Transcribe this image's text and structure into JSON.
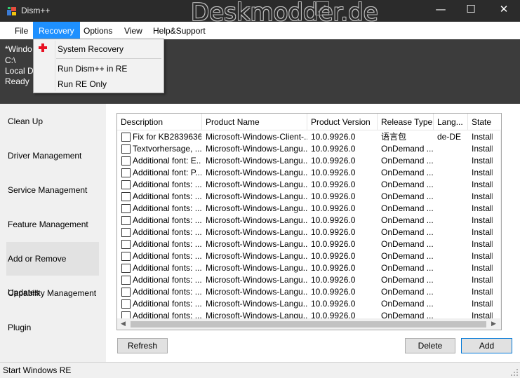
{
  "window": {
    "title": "Dism++",
    "watermark": "Deskmodder.de",
    "controls": {
      "minimize": "—",
      "maximize": "☐",
      "close": "✕"
    }
  },
  "menu": [
    "File",
    "Recovery",
    "Options",
    "View",
    "Help&Support"
  ],
  "recovery_menu": {
    "items": [
      "System Recovery",
      "Run Dism++ in RE",
      "Run RE Only"
    ],
    "icons": {
      "system_recovery": "red-cross-icon"
    },
    "accent": "#e81123"
  },
  "info": {
    "line1": "*Windo",
    "line2": "C:\\",
    "line3": "Local D",
    "line4": "Ready"
  },
  "sidebar": {
    "items": [
      "Clean Up",
      "Driver Management",
      "Service Management",
      "Feature Management",
      "Add or Remove Updates",
      "Capability Management",
      "Plugin"
    ],
    "selected": "Add or Remove Updates"
  },
  "table": {
    "columns": [
      "Description",
      "Product Name",
      "Product Version",
      "Release Type",
      "Lang...",
      "State"
    ],
    "rows": [
      [
        "Fix for KB2839636",
        "Microsoft-Windows-Client-...",
        "10.0.9926.0",
        "语言包",
        "de-DE",
        "Installe"
      ],
      [
        "Textvorhersage, ...",
        "Microsoft-Windows-Langu...",
        "10.0.9926.0",
        "OnDemand ...",
        "",
        "Installe"
      ],
      [
        "Additional font: E...",
        "Microsoft-Windows-Langu...",
        "10.0.9926.0",
        "OnDemand ...",
        "",
        "Installe"
      ],
      [
        "Additional font: P...",
        "Microsoft-Windows-Langu...",
        "10.0.9926.0",
        "OnDemand ...",
        "",
        "Installe"
      ],
      [
        "Additional fonts: ...",
        "Microsoft-Windows-Langu...",
        "10.0.9926.0",
        "OnDemand ...",
        "",
        "Installe"
      ],
      [
        "Additional fonts: ...",
        "Microsoft-Windows-Langu...",
        "10.0.9926.0",
        "OnDemand ...",
        "",
        "Installe"
      ],
      [
        "Additional fonts: ...",
        "Microsoft-Windows-Langu...",
        "10.0.9926.0",
        "OnDemand ...",
        "",
        "Installe"
      ],
      [
        "Additional fonts: ...",
        "Microsoft-Windows-Langu...",
        "10.0.9926.0",
        "OnDemand ...",
        "",
        "Installe"
      ],
      [
        "Additional fonts: ...",
        "Microsoft-Windows-Langu...",
        "10.0.9926.0",
        "OnDemand ...",
        "",
        "Installe"
      ],
      [
        "Additional fonts: ...",
        "Microsoft-Windows-Langu...",
        "10.0.9926.0",
        "OnDemand ...",
        "",
        "Installe"
      ],
      [
        "Additional fonts: ...",
        "Microsoft-Windows-Langu...",
        "10.0.9926.0",
        "OnDemand ...",
        "",
        "Installe"
      ],
      [
        "Additional fonts: ...",
        "Microsoft-Windows-Langu...",
        "10.0.9926.0",
        "OnDemand ...",
        "",
        "Installe"
      ],
      [
        "Additional fonts: ...",
        "Microsoft-Windows-Langu...",
        "10.0.9926.0",
        "OnDemand ...",
        "",
        "Installe"
      ],
      [
        "Additional fonts: ...",
        "Microsoft-Windows-Langu...",
        "10.0.9926.0",
        "OnDemand ...",
        "",
        "Installe"
      ],
      [
        "Additional fonts: ...",
        "Microsoft-Windows-Langu...",
        "10.0.9926.0",
        "OnDemand ...",
        "",
        "Installe"
      ],
      [
        "Additional fonts: ...",
        "Microsoft-Windows-Langu...",
        "10.0.9926.0",
        "OnDemand ...",
        "",
        "Installe"
      ]
    ]
  },
  "buttons": {
    "refresh": "Refresh",
    "delete": "Delete",
    "add": "Add"
  },
  "status": "Start Windows RE",
  "colors": {
    "menu_active": "#1e90ff",
    "titlebar": "#2b2b2b",
    "info_panel": "#3c3c3c"
  }
}
